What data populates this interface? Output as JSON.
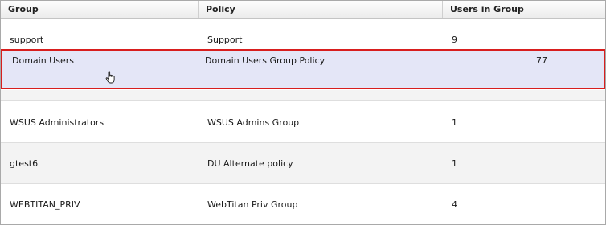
{
  "columns": {
    "group": "Group",
    "policy": "Policy",
    "users": "Users in Group"
  },
  "rows": [
    {
      "group": "support",
      "policy": "Support",
      "users": "9"
    },
    {
      "group": "Domain Users",
      "policy": "Domain Users Group Policy",
      "users": "77"
    },
    {
      "group": "WSUS Administrators",
      "policy": "WSUS Admins Group",
      "users": "1"
    },
    {
      "group": "gtest6",
      "policy": "DU Alternate policy",
      "users": "1"
    },
    {
      "group": "WEBTITAN_PRIV",
      "policy": "WebTitan Priv Group",
      "users": "4"
    }
  ],
  "selected_row": "Domain Users",
  "cursor_icon": "hand-pointer-icon",
  "colors": {
    "header_bg": "#efefef",
    "selected_bg": "#e4e6f7",
    "selected_border": "#d81e1e",
    "alt_row_bg": "#f3f3f3"
  }
}
